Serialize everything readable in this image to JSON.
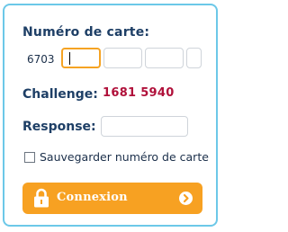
{
  "form": {
    "card_label": "Numéro de carte:",
    "card_prefix": "6703",
    "card_fields": [
      "",
      "",
      "",
      ""
    ],
    "challenge_label": "Challenge:",
    "challenge_value": "1681 5940",
    "response_label": "Response:",
    "response_value": "",
    "save_card_label": "Sauvegarder numéro de carte",
    "save_card_checked": false,
    "submit_label": "Connexion"
  },
  "colors": {
    "border": "#6cc8e8",
    "label": "#1e3f66",
    "challenge": "#b0103a",
    "button": "#f7a122",
    "active_input_border": "#f5a323"
  },
  "icons": {
    "submit_leading": "lock-icon",
    "submit_trailing": "chevron-right-circle-icon"
  }
}
